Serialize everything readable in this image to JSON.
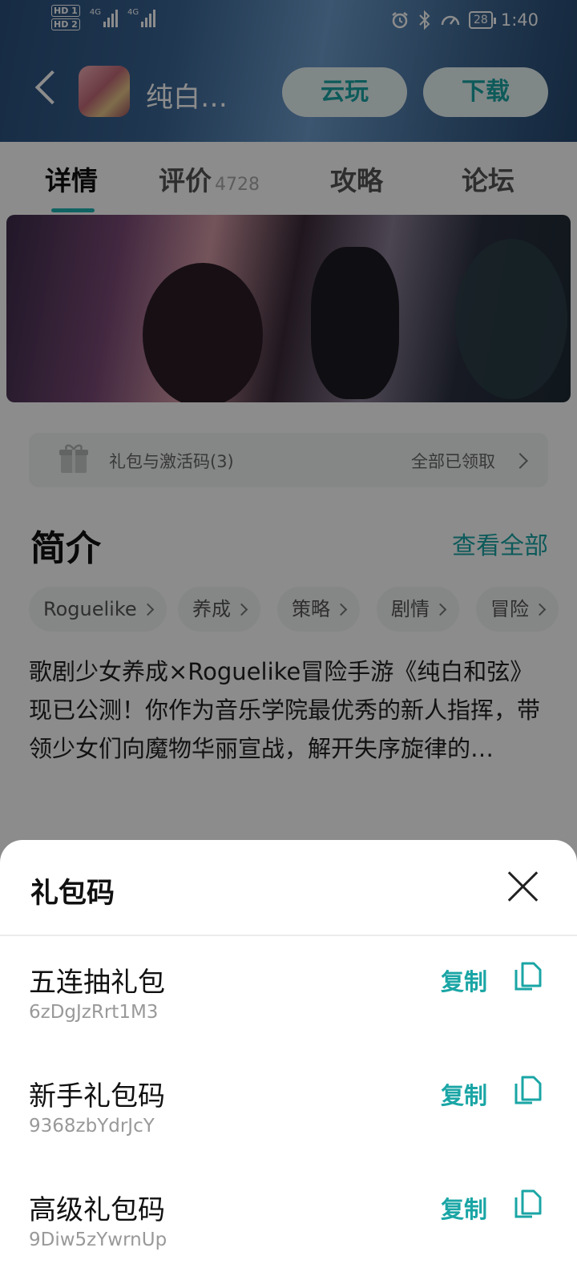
{
  "status_bar": {
    "hd1": "HD 1",
    "hd2": "HD 2",
    "signal1_label": "4G",
    "signal2_label": "4G",
    "battery": "28",
    "time": "1:40"
  },
  "header": {
    "app_name": "纯白…",
    "cloud_play": "云玩",
    "download": "下载"
  },
  "tabs": [
    {
      "label": "详情",
      "active": true
    },
    {
      "label": "评价",
      "count": "4728"
    },
    {
      "label": "攻略"
    },
    {
      "label": "论坛"
    }
  ],
  "gift_row": {
    "label": "礼包与激活码(3)",
    "status": "全部已领取"
  },
  "intro": {
    "title": "简介",
    "more": "查看全部",
    "tags": [
      "Roguelike",
      "养成",
      "策略",
      "剧情",
      "冒险"
    ],
    "description": "歌剧少女养成×Roguelike冒险手游《纯白和弦》现已公测！你作为音乐学院最优秀的新人指挥，带领少女们向魔物华丽宣战，解开失序旋律的…"
  },
  "sheet": {
    "title": "礼包码",
    "copy_label": "复制",
    "items": [
      {
        "name": "五连抽礼包",
        "code": "6zDgJzRrt1M3"
      },
      {
        "name": "新手礼包码",
        "code": "9368zbYdrJcY"
      },
      {
        "name": "高级礼包码",
        "code": "9Diw5zYwrnUp"
      }
    ]
  },
  "colors": {
    "accent": "#1aa5a5",
    "tab_indicator": "#20b3b3",
    "scrim": "rgba(0,0,0,0.45)"
  }
}
